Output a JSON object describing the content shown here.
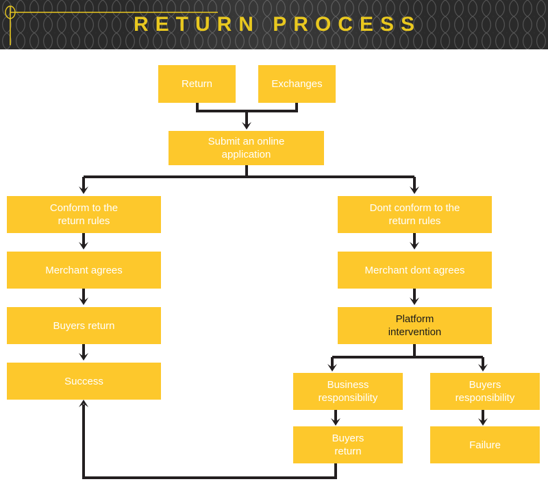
{
  "header": {
    "title": "RETURN PROCESS",
    "title_color": "#E9C81F",
    "background_color": "#2a2a2a",
    "mesh_line_color": "#555555",
    "crosshair_icon": "crosshair-target-icon"
  },
  "palette": {
    "node_fill": "#FDC82C",
    "node_text_light": "#FFFFFF",
    "node_text_dark": "#1A1A1A",
    "connector": "#231F20",
    "page_background": "#FFFFFF"
  },
  "diagram": {
    "type": "flowchart",
    "nodes": [
      {
        "id": "return",
        "label": "Return",
        "text_tone": "light"
      },
      {
        "id": "exchanges",
        "label": "Exchanges",
        "text_tone": "light"
      },
      {
        "id": "submit",
        "label": "Submit an online\napplication",
        "text_tone": "light"
      },
      {
        "id": "conform",
        "label": "Conform to the\nreturn rules",
        "text_tone": "light"
      },
      {
        "id": "merchant-agrees",
        "label": "Merchant agrees",
        "text_tone": "light"
      },
      {
        "id": "buyers-return-left",
        "label": "Buyers return",
        "text_tone": "light"
      },
      {
        "id": "success",
        "label": "Success",
        "text_tone": "light"
      },
      {
        "id": "dont-conform",
        "label": "Dont conform to the\nreturn rules",
        "text_tone": "light"
      },
      {
        "id": "merchant-dont",
        "label": "Merchant dont agrees",
        "text_tone": "light"
      },
      {
        "id": "platform",
        "label": "Platform\nintervention",
        "text_tone": "dark"
      },
      {
        "id": "business-resp",
        "label": "Business\nresponsibility",
        "text_tone": "light"
      },
      {
        "id": "buyers-resp",
        "label": "Buyers\nresponsibility",
        "text_tone": "light"
      },
      {
        "id": "buyers-return-bot",
        "label": "Buyers\nreturn",
        "text_tone": "light"
      },
      {
        "id": "failure",
        "label": "Failure",
        "text_tone": "light"
      }
    ],
    "edges": [
      {
        "from": "return",
        "to": "submit",
        "style": "elbow-merge"
      },
      {
        "from": "exchanges",
        "to": "submit",
        "style": "elbow-merge"
      },
      {
        "from": "submit",
        "to": "conform",
        "style": "elbow-split"
      },
      {
        "from": "submit",
        "to": "dont-conform",
        "style": "elbow-split"
      },
      {
        "from": "conform",
        "to": "merchant-agrees",
        "style": "straight"
      },
      {
        "from": "merchant-agrees",
        "to": "buyers-return-left",
        "style": "straight"
      },
      {
        "from": "buyers-return-left",
        "to": "success",
        "style": "straight"
      },
      {
        "from": "dont-conform",
        "to": "merchant-dont",
        "style": "straight"
      },
      {
        "from": "merchant-dont",
        "to": "platform",
        "style": "straight"
      },
      {
        "from": "platform",
        "to": "business-resp",
        "style": "elbow-split"
      },
      {
        "from": "platform",
        "to": "buyers-resp",
        "style": "elbow-split"
      },
      {
        "from": "business-resp",
        "to": "buyers-return-bot",
        "style": "straight"
      },
      {
        "from": "buyers-resp",
        "to": "failure",
        "style": "straight"
      },
      {
        "from": "buyers-return-bot",
        "to": "success",
        "style": "feedback-loop"
      }
    ]
  }
}
